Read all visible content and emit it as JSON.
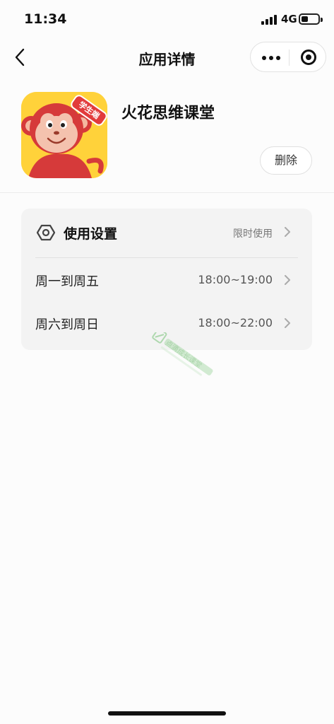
{
  "status_bar": {
    "time": "11:34",
    "network": "4G"
  },
  "nav": {
    "title": "应用详情"
  },
  "app": {
    "name": "火花思维课堂",
    "icon_badge": "学生端",
    "delete_label": "删除"
  },
  "settings": {
    "header": {
      "label": "使用设置",
      "value": "限时使用"
    },
    "rows": [
      {
        "label": "周一到周五",
        "value": "18:00~19:00"
      },
      {
        "label": "周六到周日",
        "value": "18:00~22:00"
      }
    ]
  },
  "watermark": {
    "text": "点滴成长课堂"
  },
  "colors": {
    "icon_bg": "#ffd23a",
    "monkey": "#d63a3a",
    "card_bg": "#f3f3f3"
  }
}
